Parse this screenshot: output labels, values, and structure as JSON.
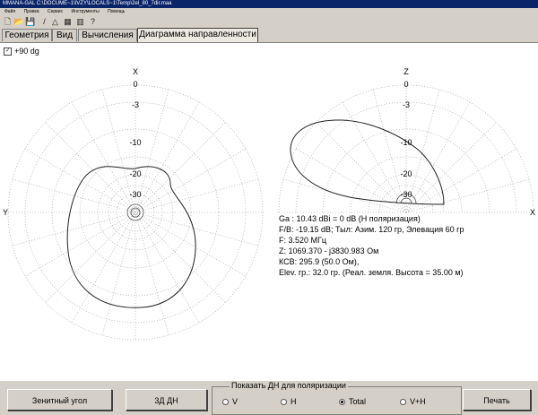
{
  "window": {
    "title": "MMANA-GAL C:\\DOCUME~1\\IVZY\\LOCALS~1\\Temp\\2el_80_7dir.maa"
  },
  "menu": [
    "Файл",
    "Правка",
    "Сервис",
    "Инструменты",
    "Помощь"
  ],
  "toolbar": [
    {
      "name": "new-icon",
      "glyph": "🗋"
    },
    {
      "name": "open-icon",
      "glyph": "📂"
    },
    {
      "name": "save-icon",
      "glyph": "💾"
    },
    {
      "name": "draw-icon",
      "glyph": "/"
    },
    {
      "name": "triangle-icon",
      "glyph": "△"
    },
    {
      "name": "table-icon",
      "glyph": "▦"
    },
    {
      "name": "book-icon",
      "glyph": "▥"
    },
    {
      "name": "help-icon",
      "glyph": "?"
    }
  ],
  "tabs": [
    "Геометрия",
    "Вид",
    "Вычисления",
    "Диаграмма направленности"
  ],
  "checkbox": {
    "label": "+90 dg",
    "checked": true,
    "mark": "✓"
  },
  "left_plot": {
    "top_axis": "X",
    "side_axis": "Y",
    "rings": [
      "0",
      "-3",
      "-10",
      "-20",
      "-30"
    ]
  },
  "right_plot": {
    "top_axis": "Z",
    "side_axis": "X",
    "rings": [
      "0",
      "-3",
      "-10",
      "-20",
      "-30"
    ]
  },
  "info": [
    "Ga : 10.43 dBi = 0 dB  (Н поляризация)",
    "F/B: -19.15 dB; Тыл: Азим. 120 гр, Элевация 60 гр",
    "F: 3.520 МГц",
    "Z: 1069.370 - j3830.983 Ом",
    "КСВ: 295.9 (50.0 Ом),",
    "Elev. гр.: 32.0 гр. (Реал. земля. Высота = 35.00 м)"
  ],
  "buttons": {
    "zenith": "Зенитный угол",
    "view3d": "3Д  ДН",
    "print": "Печать"
  },
  "polarization": {
    "title": "Показать ДН для поляризации",
    "options": [
      {
        "label": "V",
        "selected": false
      },
      {
        "label": "H",
        "selected": false
      },
      {
        "label": "Total",
        "selected": true
      },
      {
        "label": "V+H",
        "selected": false
      }
    ]
  }
}
